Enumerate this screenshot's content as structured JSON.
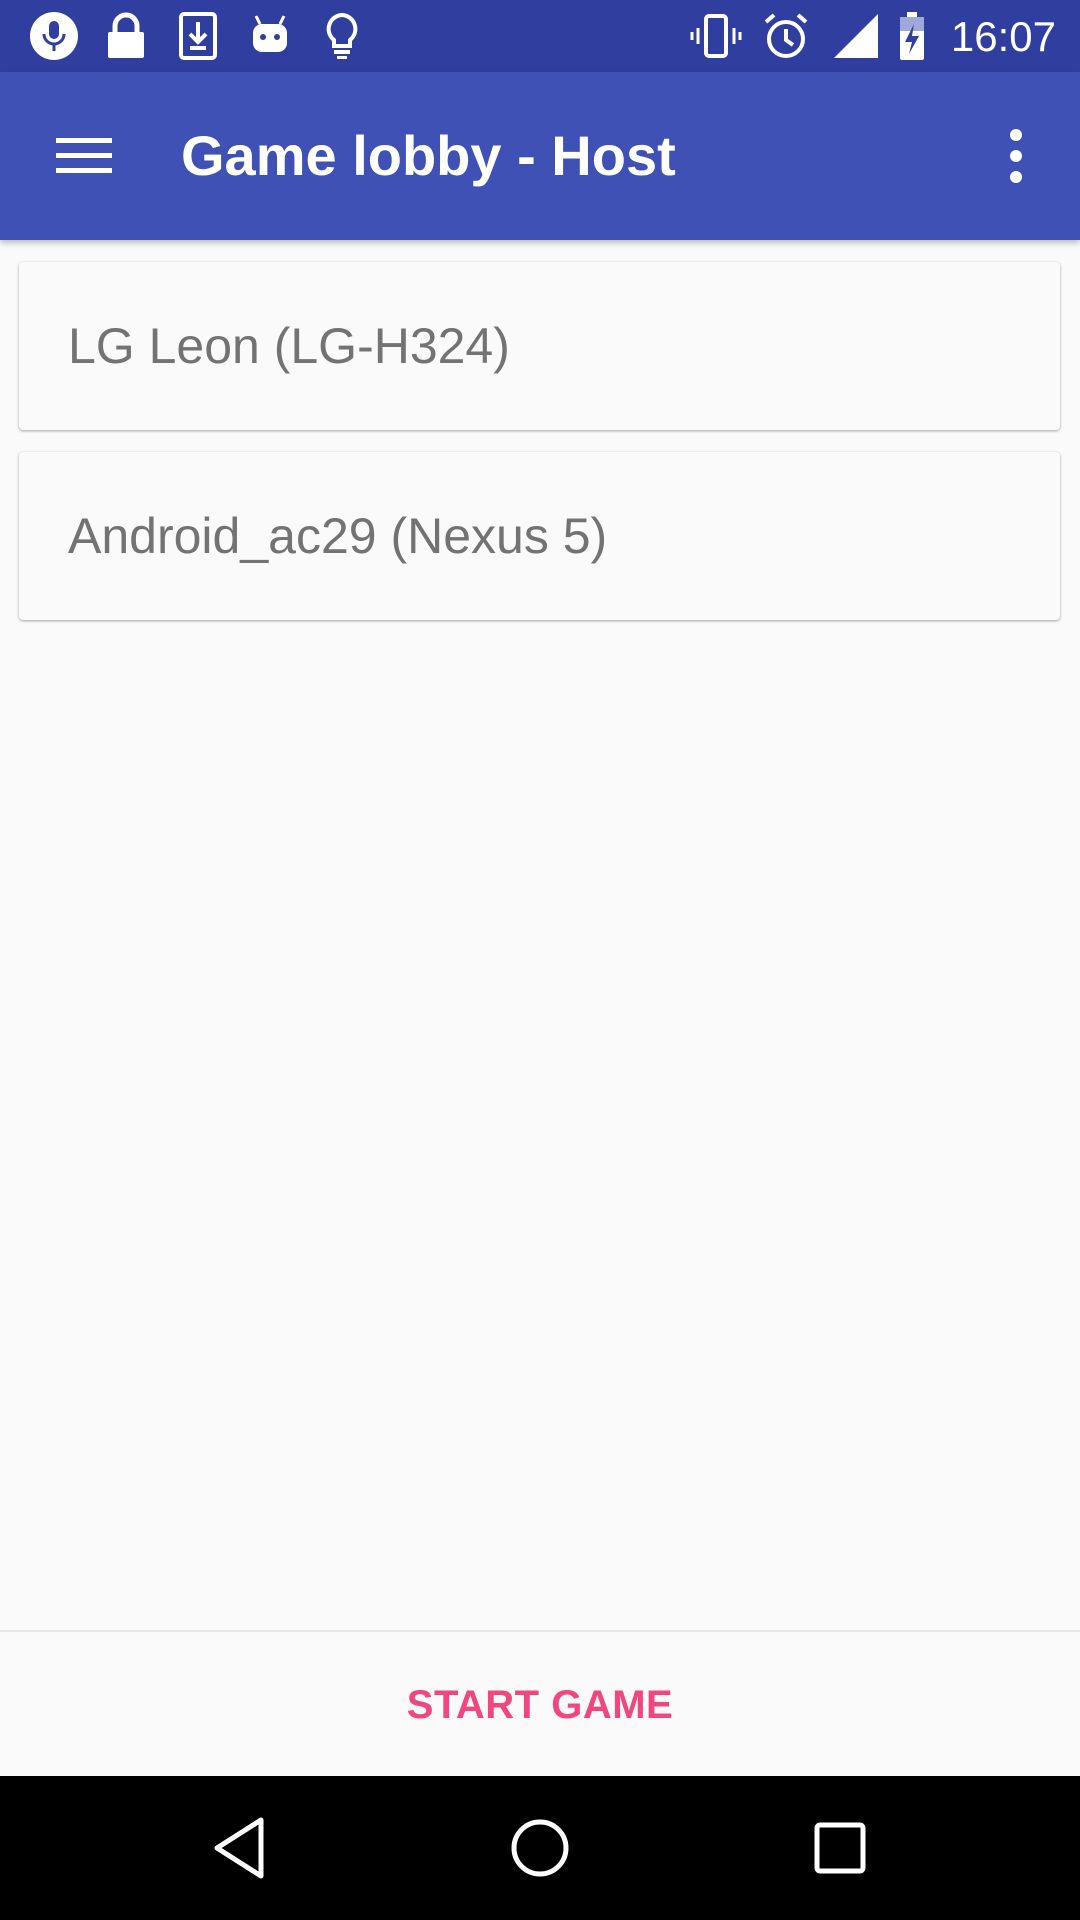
{
  "status_bar": {
    "left_icons": [
      "mic-icon",
      "lock-icon",
      "download-icon",
      "android-icon",
      "lightbulb-icon"
    ],
    "right_icons": [
      "vibrate-icon",
      "alarm-icon",
      "signal-icon",
      "battery-charging-icon"
    ],
    "time": "16:07"
  },
  "app_bar": {
    "title": "Game lobby - Host",
    "menu_icon": "hamburger-menu-icon",
    "overflow_icon": "more-vert-icon",
    "color": "#3f51b5"
  },
  "players": [
    {
      "label": "LG Leon (LG-H324)"
    },
    {
      "label": "Android_ac29 (Nexus 5)"
    }
  ],
  "actions": {
    "start_label": "START GAME",
    "accent_color": "#f2467f"
  },
  "nav_bar": {
    "icons": [
      "back-icon",
      "home-icon",
      "recents-icon"
    ]
  }
}
